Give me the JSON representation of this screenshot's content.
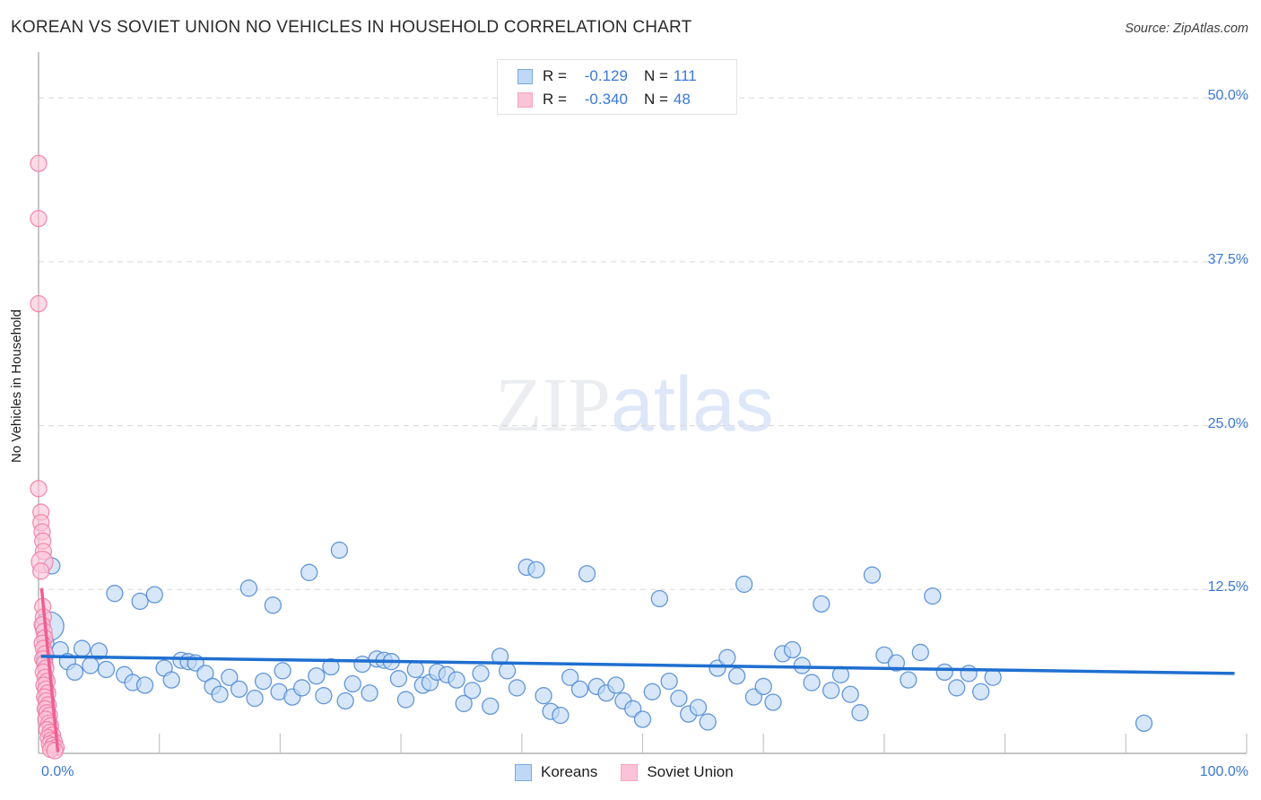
{
  "header": {
    "title": "KOREAN VS SOVIET UNION NO VEHICLES IN HOUSEHOLD CORRELATION CHART",
    "source": "Source: ZipAtlas.com"
  },
  "watermark": {
    "part1": "ZIP",
    "part2": "atlas"
  },
  "correlation_legend": {
    "rows": [
      {
        "series": "Koreans",
        "r_label": "R =",
        "r_value": "-0.129",
        "n_label": "N =",
        "n_value": "111",
        "color": "#bed8f5"
      },
      {
        "series": "Soviet Union",
        "r_label": "R =",
        "r_value": "-0.340",
        "n_label": "N =",
        "n_value": "48",
        "color": "#fbc3d7"
      }
    ]
  },
  "series_legend": [
    {
      "label": "Koreans",
      "color": "#bed8f5",
      "border": "#7aa9dd"
    },
    {
      "label": "Soviet Union",
      "color": "#fbc3d7",
      "border": "#f6a5c0"
    }
  ],
  "axes": {
    "y_title": "No Vehicles in Household",
    "y_ticks": [
      "50.0%",
      "37.5%",
      "25.0%",
      "12.5%"
    ],
    "x_ticks": [
      "0.0%",
      "100.0%"
    ]
  },
  "chart_data": {
    "type": "scatter",
    "title": "KOREAN VS SOVIET UNION NO VEHICLES IN HOUSEHOLD CORRELATION CHART",
    "xlabel": "",
    "ylabel": "No Vehicles in Household",
    "xlim": [
      0,
      100
    ],
    "ylim": [
      0,
      53.5
    ],
    "x_tick_values": [
      0,
      100
    ],
    "x_tick_labels": [
      "0.0%",
      "100.0%"
    ],
    "y_tick_values": [
      12.5,
      25.0,
      37.5,
      50.0
    ],
    "y_tick_labels": [
      "12.5%",
      "25.0%",
      "37.5%",
      "50.0%"
    ],
    "grid": "horizontal-dashed",
    "legend_position": "bottom-center",
    "series": [
      {
        "name": "Koreans",
        "color": "#bed8f5",
        "border": "#4a86d4",
        "R": -0.129,
        "N": 111,
        "trendline": {
          "x0": 0.2,
          "y0": 7.4,
          "x1": 99.0,
          "y1": 6.1,
          "color": "#1f6fd0"
        },
        "points": [
          [
            0.9,
            9.7,
            16
          ],
          [
            0.6,
            8.4,
            9
          ],
          [
            0.5,
            7.2,
            9
          ],
          [
            1.1,
            14.3,
            9
          ],
          [
            1.8,
            7.9,
            9
          ],
          [
            2.4,
            7.0,
            9
          ],
          [
            3.0,
            6.2,
            9
          ],
          [
            3.6,
            8.0,
            9
          ],
          [
            4.3,
            6.7,
            9
          ],
          [
            5.0,
            7.8,
            9
          ],
          [
            5.6,
            6.4,
            9
          ],
          [
            6.3,
            12.2,
            9
          ],
          [
            7.1,
            6.0,
            9
          ],
          [
            7.8,
            5.4,
            9
          ],
          [
            8.4,
            11.6,
            9
          ],
          [
            8.8,
            5.2,
            9
          ],
          [
            9.6,
            12.1,
            9
          ],
          [
            10.4,
            6.5,
            9
          ],
          [
            11.0,
            5.6,
            9
          ],
          [
            11.8,
            7.1,
            9
          ],
          [
            12.4,
            7.0,
            9
          ],
          [
            13.0,
            6.9,
            9
          ],
          [
            13.8,
            6.1,
            9
          ],
          [
            14.4,
            5.1,
            9
          ],
          [
            15.0,
            4.5,
            9
          ],
          [
            15.8,
            5.8,
            9
          ],
          [
            16.6,
            4.9,
            9
          ],
          [
            17.4,
            12.6,
            9
          ],
          [
            17.9,
            4.2,
            9
          ],
          [
            18.6,
            5.5,
            9
          ],
          [
            19.4,
            11.3,
            9
          ],
          [
            19.9,
            4.7,
            9
          ],
          [
            20.2,
            6.3,
            9
          ],
          [
            21.0,
            4.3,
            9
          ],
          [
            21.8,
            5.0,
            9
          ],
          [
            22.4,
            13.8,
            9
          ],
          [
            23.0,
            5.9,
            9
          ],
          [
            23.6,
            4.4,
            9
          ],
          [
            24.2,
            6.6,
            9
          ],
          [
            24.9,
            15.5,
            9
          ],
          [
            25.4,
            4.0,
            9
          ],
          [
            26.0,
            5.3,
            9
          ],
          [
            26.8,
            6.8,
            9
          ],
          [
            27.4,
            4.6,
            9
          ],
          [
            28.0,
            7.2,
            9
          ],
          [
            28.6,
            7.1,
            9
          ],
          [
            29.2,
            7.0,
            9
          ],
          [
            29.8,
            5.7,
            9
          ],
          [
            30.4,
            4.1,
            9
          ],
          [
            31.2,
            6.4,
            9
          ],
          [
            31.8,
            5.2,
            9
          ],
          [
            32.4,
            5.4,
            9
          ],
          [
            33.0,
            6.2,
            9
          ],
          [
            33.8,
            6.0,
            9
          ],
          [
            34.6,
            5.6,
            9
          ],
          [
            35.2,
            3.8,
            9
          ],
          [
            35.9,
            4.8,
            9
          ],
          [
            36.6,
            6.1,
            9
          ],
          [
            37.4,
            3.6,
            9
          ],
          [
            38.2,
            7.4,
            9
          ],
          [
            38.8,
            6.3,
            9
          ],
          [
            39.6,
            5.0,
            9
          ],
          [
            40.4,
            14.2,
            9
          ],
          [
            41.2,
            14.0,
            9
          ],
          [
            41.8,
            4.4,
            9
          ],
          [
            42.4,
            3.2,
            9
          ],
          [
            43.2,
            2.9,
            9
          ],
          [
            44.0,
            5.8,
            9
          ],
          [
            44.8,
            4.9,
            9
          ],
          [
            45.4,
            13.7,
            9
          ],
          [
            46.2,
            5.1,
            9
          ],
          [
            47.0,
            4.6,
            9
          ],
          [
            47.8,
            5.2,
            9
          ],
          [
            48.4,
            4.0,
            9
          ],
          [
            49.2,
            3.4,
            9
          ],
          [
            50.0,
            2.6,
            9
          ],
          [
            50.8,
            4.7,
            9
          ],
          [
            51.4,
            11.8,
            9
          ],
          [
            52.2,
            5.5,
            9
          ],
          [
            53.0,
            4.2,
            9
          ],
          [
            53.8,
            3.0,
            9
          ],
          [
            54.6,
            3.5,
            9
          ],
          [
            55.4,
            2.4,
            9
          ],
          [
            56.2,
            6.5,
            9
          ],
          [
            57.0,
            7.3,
            9
          ],
          [
            57.8,
            5.9,
            9
          ],
          [
            58.4,
            12.9,
            9
          ],
          [
            59.2,
            4.3,
            9
          ],
          [
            60.0,
            5.1,
            9
          ],
          [
            60.8,
            3.9,
            9
          ],
          [
            61.6,
            7.6,
            9
          ],
          [
            62.4,
            7.9,
            9
          ],
          [
            63.2,
            6.7,
            9
          ],
          [
            64.0,
            5.4,
            9
          ],
          [
            64.8,
            11.4,
            9
          ],
          [
            65.6,
            4.8,
            9
          ],
          [
            66.4,
            6.0,
            9
          ],
          [
            67.2,
            4.5,
            9
          ],
          [
            68.0,
            3.1,
            9
          ],
          [
            69.0,
            13.6,
            9
          ],
          [
            70.0,
            7.5,
            9
          ],
          [
            71.0,
            6.9,
            9
          ],
          [
            72.0,
            5.6,
            9
          ],
          [
            73.0,
            7.7,
            9
          ],
          [
            74.0,
            12.0,
            9
          ],
          [
            75.0,
            6.2,
            9
          ],
          [
            76.0,
            5.0,
            9
          ],
          [
            77.0,
            6.1,
            9
          ],
          [
            78.0,
            4.7,
            9
          ],
          [
            79.0,
            5.8,
            9
          ],
          [
            91.5,
            2.3,
            9
          ]
        ]
      },
      {
        "name": "Soviet Union",
        "color": "#fbc3d7",
        "border": "#f07ba6",
        "R": -0.34,
        "N": 48,
        "trendline": {
          "x0": 0.25,
          "y0": 12.6,
          "x1": 1.6,
          "y1": 0.1,
          "color": "#ef5e92"
        },
        "points": [
          [
            0.0,
            45.0,
            9
          ],
          [
            0.0,
            40.8,
            9
          ],
          [
            0.0,
            34.3,
            9
          ],
          [
            0.0,
            20.2,
            9
          ],
          [
            0.2,
            18.4,
            9
          ],
          [
            0.2,
            17.6,
            9
          ],
          [
            0.3,
            16.9,
            9
          ],
          [
            0.35,
            16.2,
            9
          ],
          [
            0.4,
            15.4,
            9
          ],
          [
            0.3,
            14.6,
            12
          ],
          [
            0.2,
            13.9,
            9
          ],
          [
            0.35,
            11.2,
            9
          ],
          [
            0.4,
            10.4,
            9
          ],
          [
            0.3,
            9.8,
            9
          ],
          [
            0.45,
            9.3,
            9
          ],
          [
            0.5,
            8.8,
            9
          ],
          [
            0.3,
            8.4,
            9
          ],
          [
            0.4,
            8.0,
            9
          ],
          [
            0.55,
            7.6,
            9
          ],
          [
            0.35,
            7.2,
            9
          ],
          [
            0.5,
            6.9,
            9
          ],
          [
            0.6,
            6.5,
            9
          ],
          [
            0.4,
            6.2,
            9
          ],
          [
            0.55,
            5.8,
            9
          ],
          [
            0.7,
            5.5,
            9
          ],
          [
            0.45,
            5.2,
            9
          ],
          [
            0.6,
            4.9,
            9
          ],
          [
            0.75,
            4.6,
            9
          ],
          [
            0.5,
            4.3,
            9
          ],
          [
            0.65,
            4.0,
            9
          ],
          [
            0.8,
            3.7,
            9
          ],
          [
            0.55,
            3.4,
            9
          ],
          [
            0.7,
            3.1,
            9
          ],
          [
            0.9,
            2.9,
            9
          ],
          [
            0.6,
            2.6,
            9
          ],
          [
            0.85,
            2.3,
            9
          ],
          [
            1.0,
            2.1,
            9
          ],
          [
            0.7,
            1.8,
            9
          ],
          [
            0.95,
            1.6,
            9
          ],
          [
            1.15,
            1.4,
            9
          ],
          [
            0.8,
            1.2,
            9
          ],
          [
            1.05,
            1.0,
            9
          ],
          [
            1.3,
            0.9,
            9
          ],
          [
            0.9,
            0.7,
            9
          ],
          [
            1.2,
            0.6,
            9
          ],
          [
            1.45,
            0.45,
            9
          ],
          [
            1.0,
            0.3,
            9
          ],
          [
            1.35,
            0.2,
            9
          ]
        ]
      }
    ]
  }
}
